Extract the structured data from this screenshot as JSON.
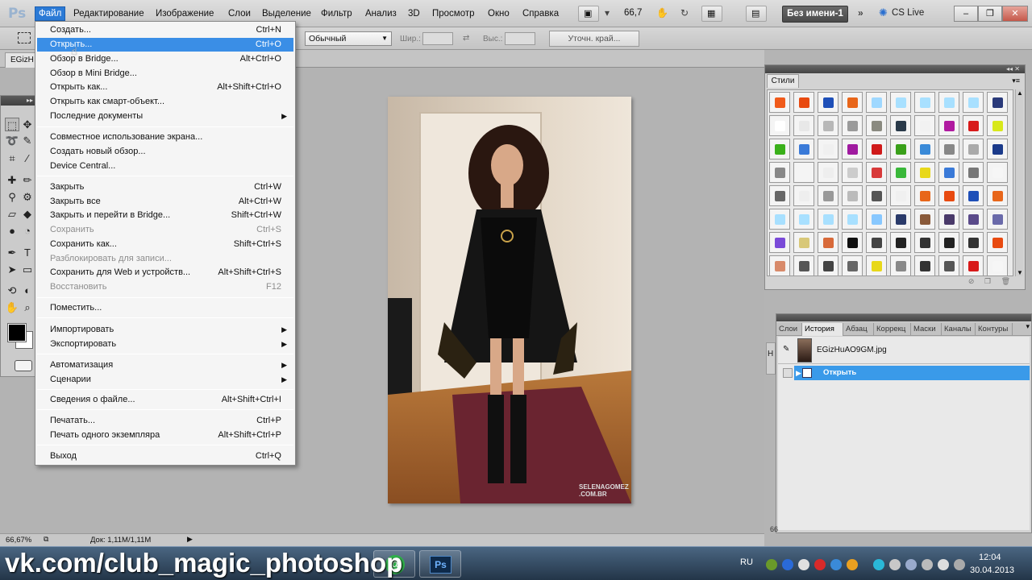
{
  "app": {
    "logo": "Ps"
  },
  "menubar": {
    "items": [
      "Файл",
      "Редактирование",
      "Изображение",
      "Слои",
      "Выделение",
      "Фильтр",
      "Анализ",
      "3D",
      "Просмотр",
      "Окно",
      "Справка"
    ],
    "zoom": "66,7",
    "doc_tab_button": "Без имени-1",
    "cs_live": "CS Live"
  },
  "options": {
    "style_select": "Обычный",
    "width_label": "Шир.:",
    "height_label": "Выс.:",
    "refine_button": "Уточн. край..."
  },
  "document": {
    "tab_label": "EGizH"
  },
  "file_menu": {
    "groups": [
      [
        {
          "label": "Создать...",
          "shortcut": "Ctrl+N"
        },
        {
          "label": "Открыть...",
          "shortcut": "Ctrl+O",
          "highlight": true
        },
        {
          "label": "Обзор в Bridge...",
          "shortcut": "Alt+Ctrl+O"
        },
        {
          "label": "Обзор в Mini Bridge...",
          "shortcut": ""
        },
        {
          "label": "Открыть как...",
          "shortcut": "Alt+Shift+Ctrl+O"
        },
        {
          "label": "Открыть как смарт-объект...",
          "shortcut": ""
        },
        {
          "label": "Последние документы",
          "shortcut": "",
          "submenu": true
        }
      ],
      [
        {
          "label": "Совместное использование экрана...",
          "shortcut": ""
        },
        {
          "label": "Создать новый обзор...",
          "shortcut": ""
        },
        {
          "label": "Device Central...",
          "shortcut": ""
        }
      ],
      [
        {
          "label": "Закрыть",
          "shortcut": "Ctrl+W"
        },
        {
          "label": "Закрыть все",
          "shortcut": "Alt+Ctrl+W"
        },
        {
          "label": "Закрыть и перейти в Bridge...",
          "shortcut": "Shift+Ctrl+W"
        },
        {
          "label": "Сохранить",
          "shortcut": "Ctrl+S",
          "disabled": true
        },
        {
          "label": "Сохранить как...",
          "shortcut": "Shift+Ctrl+S"
        },
        {
          "label": "Разблокировать для записи...",
          "shortcut": "",
          "disabled": true
        },
        {
          "label": "Сохранить для Web и устройств...",
          "shortcut": "Alt+Shift+Ctrl+S"
        },
        {
          "label": "Восстановить",
          "shortcut": "F12",
          "disabled": true
        }
      ],
      [
        {
          "label": "Поместить...",
          "shortcut": ""
        }
      ],
      [
        {
          "label": "Импортировать",
          "shortcut": "",
          "submenu": true
        },
        {
          "label": "Экспортировать",
          "shortcut": "",
          "submenu": true
        }
      ],
      [
        {
          "label": "Автоматизация",
          "shortcut": "",
          "submenu": true
        },
        {
          "label": "Сценарии",
          "shortcut": "",
          "submenu": true
        }
      ],
      [
        {
          "label": "Сведения о файле...",
          "shortcut": "Alt+Shift+Ctrl+I"
        }
      ],
      [
        {
          "label": "Печатать...",
          "shortcut": "Ctrl+P"
        },
        {
          "label": "Печать одного экземпляра",
          "shortcut": "Alt+Shift+Ctrl+P"
        }
      ],
      [
        {
          "label": "Выход",
          "shortcut": "Ctrl+Q"
        }
      ]
    ]
  },
  "styles_panel": {
    "tab_label": "Стили",
    "swatch_colors": [
      "#f05a1a",
      "#e84a10",
      "#1e4fb8",
      "#e8661a",
      "#9fd8ff",
      "#a8e0ff",
      "#a8e0ff",
      "#a8e0ff",
      "#a8e0ff",
      "#2a3a7a",
      "#ffffff",
      "#e8e8e8",
      "#b8b8b8",
      "#9a9a9a",
      "#8a8a80",
      "#2a3a4a",
      "#f2f2f2",
      "#b01aa0",
      "#d81a1a",
      "#d8e81a",
      "#3ab01a",
      "#3a7ad8",
      "#f0f0f0",
      "#a01aa0",
      "#d01a1a",
      "#3aa01a",
      "#3a8ad8",
      "#888888",
      "#aaaaaa",
      "#1a3a8a",
      "#888888",
      "#f4f4f4",
      "#eeeeee",
      "#cccccc",
      "#d83a3a",
      "#3ab83a",
      "#e8d81a",
      "#3a7ad8",
      "#777777",
      "#f6f6f6",
      "#666666",
      "#eeeeee",
      "#999999",
      "#bbbbbb",
      "#555555",
      "#f0f0f0",
      "#e8661a",
      "#e84a10",
      "#1e4fb8",
      "#e8661a",
      "#a8e0ff",
      "#a8e0ff",
      "#a8e0ff",
      "#a8e0ff",
      "#88c8ff",
      "#2a3a6a",
      "#8a5a3a",
      "#4a3a6a",
      "#5a4a8a",
      "#6a6aaa",
      "#7a4ad8",
      "#d8c878",
      "#d86a3a",
      "#111111",
      "#444444",
      "#222222",
      "#333333",
      "#222222",
      "#333333",
      "#e84a10",
      "#d88a6a",
      "#555555",
      "#444444",
      "#666666",
      "#e8d81a",
      "#888888",
      "#333333",
      "#555555",
      "#d81a1a",
      "#f6f6f6"
    ]
  },
  "history_panel": {
    "tabs": [
      "Слои",
      "История",
      "Абзац",
      "Коррекц",
      "Маски",
      "Каналы",
      "Контуры"
    ],
    "snapshot": "EGizHuAO9GM.jpg",
    "state": "Открыть",
    "edge_label": "Н"
  },
  "status": {
    "zoom": "66,67%",
    "doc": "Док: 1,11M/1,11M",
    "side": "66"
  },
  "canvas": {
    "watermark": "SELENAGOMEZ\n.COM.BR"
  },
  "taskbar": {
    "watermark": "vk.com/club_magic_photoshop",
    "lang": "RU",
    "time": "12:04",
    "date": "30.04.2013",
    "ps_label": "Ps",
    "mail_label": "@"
  }
}
